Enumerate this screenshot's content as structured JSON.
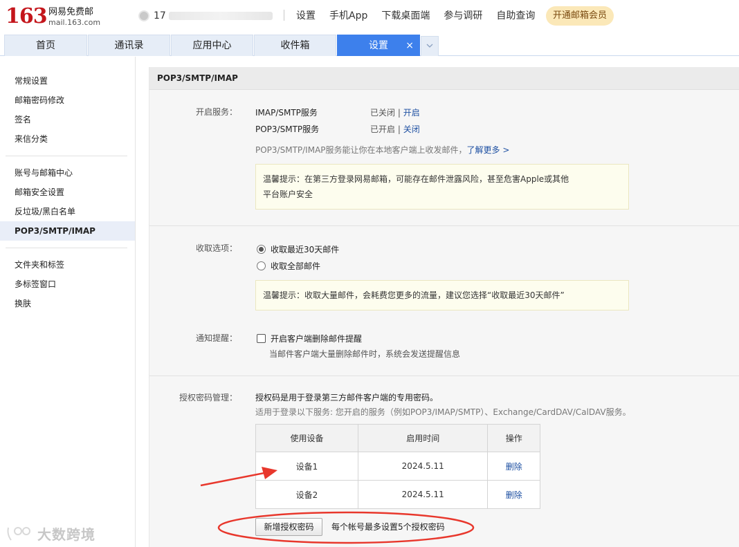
{
  "brand": {
    "number": "163",
    "name_cn": "网易免费邮",
    "domain": "mail.163.com"
  },
  "user": {
    "name_visible": "17",
    "avatar_icon": "user-avatar-icon"
  },
  "topnav": [
    "设置",
    "手机App",
    "下载桌面端",
    "参与调研",
    "自助查询"
  ],
  "vip_button": "开通邮箱会员",
  "tabs": [
    "首页",
    "通讯录",
    "应用中心",
    "收件箱",
    "设置"
  ],
  "active_tab": "设置",
  "tab_close": "×",
  "tab_more_icon": "chevron-down-icon",
  "sidebar": {
    "group1": [
      "常规设置",
      "邮箱密码修改",
      "签名",
      "来信分类"
    ],
    "group2": [
      "账号与邮箱中心",
      "邮箱安全设置",
      "反垃圾/黑白名单",
      "POP3/SMTP/IMAP"
    ],
    "group3": [
      "文件夹和标签",
      "多标签窗口",
      "换肤"
    ],
    "active": "POP3/SMTP/IMAP"
  },
  "panel": {
    "title": "POP3/SMTP/IMAP",
    "services": {
      "label": "开启服务：",
      "rows": [
        {
          "name": "IMAP/SMTP服务",
          "status": "已关闭",
          "sep": "|",
          "action": "开启"
        },
        {
          "name": "POP3/SMTP服务",
          "status": "已开启",
          "sep": "|",
          "action": "关闭"
        }
      ],
      "desc": "POP3/SMTP/IMAP服务能让你在本地客户端上收发邮件，",
      "learn_more": "了解更多 >",
      "tip_line1": "温馨提示：在第三方登录网易邮箱，可能存在邮件泄露风险，甚至危害Apple或其他",
      "tip_line2": "平台账户安全"
    },
    "fetch": {
      "label": "收取选项：",
      "options": [
        "收取最近30天邮件",
        "收取全部邮件"
      ],
      "selected": 0,
      "tip": "温馨提示：收取大量邮件，会耗费您更多的流量，建议您选择“收取最近30天邮件”"
    },
    "notify": {
      "label": "通知提醒：",
      "checkbox": "开启客户端删除邮件提醒",
      "checked": false,
      "desc": "当邮件客户端大量删除邮件时，系统会发送提醒信息"
    },
    "auth": {
      "label": "授权密码管理：",
      "line1": "授权码是用于登录第三方邮件客户端的专用密码。",
      "line2": "适用于登录以下服务: 您开启的服务（例如POP3/IMAP/SMTP）、Exchange/CardDAV/CalDAV服务。",
      "columns": [
        "使用设备",
        "启用时间",
        "操作"
      ],
      "rows": [
        {
          "device": "设备1",
          "time": "2024.5.11",
          "action": "删除"
        },
        {
          "device": "设备2",
          "time": "2024.5.11",
          "action": "删除"
        }
      ],
      "add_button": "新增授权密码",
      "limit_note": "每个帐号最多设置5个授权密码"
    }
  },
  "annotation_colors": {
    "arrow": "#e8372c",
    "ellipse": "#e8372c"
  },
  "watermark": "大数跨境",
  "colors": {
    "accent": "#3d80ec",
    "brand_red": "#c4161c",
    "link": "#1e50a2",
    "tip_bg": "#fdfdee"
  }
}
